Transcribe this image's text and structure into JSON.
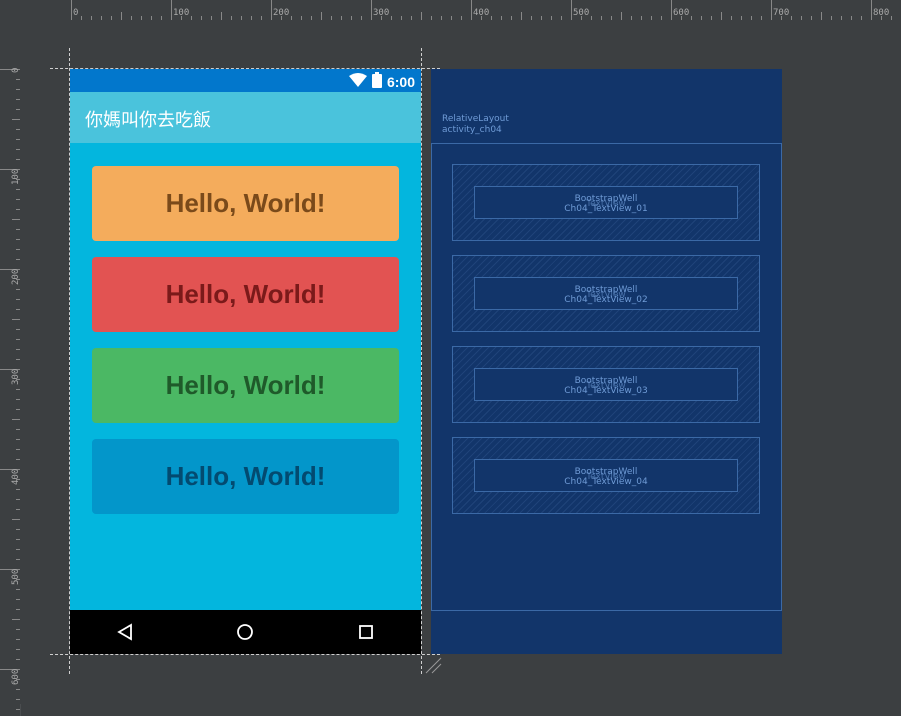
{
  "ruler": {
    "top_labels": [
      "0",
      "100",
      "200",
      "300",
      "400",
      "500",
      "600",
      "700",
      "800"
    ],
    "left_labels": [
      "0",
      "100",
      "200",
      "300",
      "400",
      "500",
      "600"
    ]
  },
  "phone": {
    "status": {
      "time": "6:00",
      "icons": [
        "wifi-icon",
        "battery-icon"
      ]
    },
    "app_title": "你媽叫你去吃飯",
    "wells": [
      {
        "text": "Hello, World!",
        "bg": "#f4ac5c",
        "fg": "#7a4a1a"
      },
      {
        "text": "Hello, World!",
        "bg": "#e25352",
        "fg": "#7a1a1a"
      },
      {
        "text": "Hello, World!",
        "bg": "#4bb864",
        "fg": "#1f5a2a"
      },
      {
        "text": "Hello, World!",
        "bg": "#0396ca",
        "fg": "#034a70"
      }
    ],
    "nav_icons": [
      "back-icon",
      "home-icon",
      "recents-icon"
    ]
  },
  "blueprint": {
    "root_type": "RelativeLayout",
    "root_id": "activity_ch04",
    "wells": [
      {
        "type": "BootstrapWell",
        "child_type": "TextView",
        "child_id": "Ch04_TextView_01"
      },
      {
        "type": "BootstrapWell",
        "child_type": "TextView",
        "child_id": "Ch04_TextView_02"
      },
      {
        "type": "BootstrapWell",
        "child_type": "TextView",
        "child_id": "Ch04_TextView_03"
      },
      {
        "type": "BootstrapWell",
        "child_type": "TextView",
        "child_id": "Ch04_TextView_04"
      }
    ]
  }
}
